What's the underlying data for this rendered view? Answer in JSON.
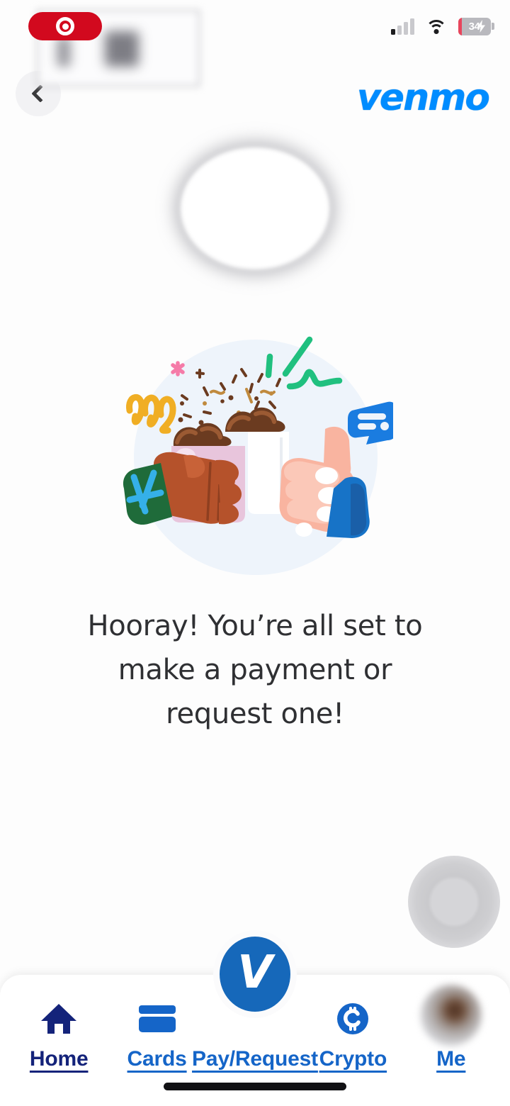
{
  "app": {
    "name": "Venmo",
    "brand_wordmark": "venmo",
    "brand_color": "#008CFF",
    "background_color": "#fdfdfd"
  },
  "status_bar": {
    "recording_indicator": {
      "icon": "record-circle-icon",
      "color": "#d2091e"
    },
    "signal_icon": "cellular-signal-icon",
    "signal_bars_filled": 1,
    "signal_bars_total": 4,
    "wifi_icon": "wifi-icon",
    "battery": {
      "level": "34",
      "charging": true,
      "icon": "battery-charging-icon",
      "fill_color": "#e8455c"
    }
  },
  "header": {
    "back_button_icon": "chevron-left-icon",
    "redacted_overlay_label": "redacted-account-info",
    "logo_text": "venmo"
  },
  "redaction": {
    "circle_label": "redacted-avatar-region"
  },
  "illustration": {
    "name": "cheers-mugs-illustration",
    "description": "Two hands toasting mugs of hot chocolate with whipped cream, confetti and sparkles",
    "colors": {
      "background_circle": "#eef4fb",
      "left_sleeve": "#1f6b3a",
      "left_sleeve_accent": "#35b0e8",
      "left_skin": "#b5522b",
      "left_mug": "#e8c5dc",
      "right_skin": "#f9b4a0",
      "right_sleeve": "#1773c7",
      "right_mug": "#ffffff",
      "whipped_cream": "#6b3b20",
      "squiggle_yellow": "#f0ae24",
      "squiggle_green": "#20c07f",
      "sparkle_pink": "#f57ba8",
      "chat_bubble_blue": "#1a7ce0"
    }
  },
  "main": {
    "message_line_1": "Hooray! You’re all set",
    "message_line_2": "to make a payment or",
    "message_line_3": "request one!",
    "message_full": "Hooray! You’re all set to make a payment or request one!"
  },
  "assistive_button": {
    "label": "assistive-touch-button",
    "color": "#d3d3d6"
  },
  "bottom_nav": {
    "active_item": "Home",
    "active_color": "#14237a",
    "inactive_color": "#1565c8",
    "items": [
      {
        "label": "Home",
        "icon": "home-icon",
        "active": true
      },
      {
        "label": "Cards",
        "icon": "card-icon",
        "active": false
      },
      {
        "label": "Pay/Request",
        "icon": "venmo-v-icon",
        "active": false
      },
      {
        "label": "Crypto",
        "icon": "crypto-c-icon",
        "active": false
      },
      {
        "label": "Me",
        "icon": "avatar-icon",
        "active": false
      }
    ],
    "fab": {
      "label": "Pay/Request",
      "glyph": "V",
      "color": "#1668ba"
    }
  },
  "system": {
    "home_indicator": "home-indicator-bar"
  }
}
